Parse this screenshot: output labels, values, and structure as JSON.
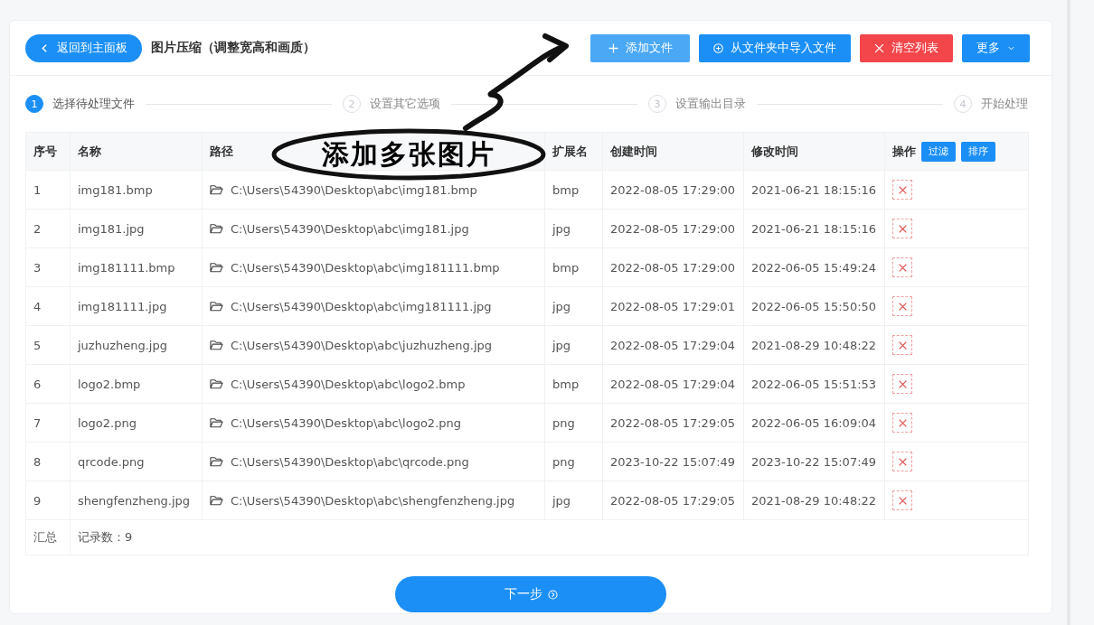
{
  "header": {
    "back_button": "返回到主面板",
    "title": "图片压缩（调整宽高和画质）",
    "buttons": [
      {
        "label": "添加文件",
        "kind": "add"
      },
      {
        "label": "从文件夹中导入文件",
        "kind": "import"
      },
      {
        "label": "清空列表",
        "kind": "clear"
      },
      {
        "label": "更多",
        "kind": "more"
      }
    ]
  },
  "steps": [
    {
      "number": "1",
      "label": "选择待处理文件",
      "selected": true
    },
    {
      "number": "2",
      "label": "设置其它选项",
      "selected": false
    },
    {
      "number": "3",
      "label": "设置输出目录",
      "selected": false
    },
    {
      "number": "4",
      "label": "开始处理",
      "selected": false
    }
  ],
  "table": {
    "columns": [
      "序号",
      "名称",
      "路径",
      "扩展名",
      "创建时间",
      "修改时间",
      "操作"
    ],
    "header_buttons": [
      "过滤",
      "排序"
    ],
    "rows": [
      {
        "index": "1",
        "name": "img181.bmp",
        "path": "C:\\Users\\54390\\Desktop\\abc\\img181.bmp",
        "ext": "bmp",
        "created": "2022-08-05 17:29:00",
        "modified": "2021-06-21 18:15:16"
      },
      {
        "index": "2",
        "name": "img181.jpg",
        "path": "C:\\Users\\54390\\Desktop\\abc\\img181.jpg",
        "ext": "jpg",
        "created": "2022-08-05 17:29:00",
        "modified": "2021-06-21 18:15:16"
      },
      {
        "index": "3",
        "name": "img181111.bmp",
        "path": "C:\\Users\\54390\\Desktop\\abc\\img181111.bmp",
        "ext": "bmp",
        "created": "2022-08-05 17:29:00",
        "modified": "2022-06-05 15:49:24"
      },
      {
        "index": "4",
        "name": "img181111.jpg",
        "path": "C:\\Users\\54390\\Desktop\\abc\\img181111.jpg",
        "ext": "jpg",
        "created": "2022-08-05 17:29:01",
        "modified": "2022-06-05 15:50:50"
      },
      {
        "index": "5",
        "name": "juzhuzheng.jpg",
        "path": "C:\\Users\\54390\\Desktop\\abc\\juzhuzheng.jpg",
        "ext": "jpg",
        "created": "2022-08-05 17:29:04",
        "modified": "2021-08-29 10:48:22"
      },
      {
        "index": "6",
        "name": "logo2.bmp",
        "path": "C:\\Users\\54390\\Desktop\\abc\\logo2.bmp",
        "ext": "bmp",
        "created": "2022-08-05 17:29:04",
        "modified": "2022-06-05 15:51:53"
      },
      {
        "index": "7",
        "name": "logo2.png",
        "path": "C:\\Users\\54390\\Desktop\\abc\\logo2.png",
        "ext": "png",
        "created": "2022-08-05 17:29:05",
        "modified": "2022-06-05 16:09:04"
      },
      {
        "index": "8",
        "name": "qrcode.png",
        "path": "C:\\Users\\54390\\Desktop\\abc\\qrcode.png",
        "ext": "png",
        "created": "2023-10-22 15:07:49",
        "modified": "2023-10-22 15:07:49"
      },
      {
        "index": "9",
        "name": "shengfenzheng.jpg",
        "path": "C:\\Users\\54390\\Desktop\\abc\\shengfenzheng.jpg",
        "ext": "jpg",
        "created": "2022-08-05 17:29:05",
        "modified": "2021-08-29 10:48:22"
      }
    ],
    "summary": {
      "label": "汇总",
      "count": "记录数：9"
    }
  },
  "next_button": "下一步",
  "annotation": {
    "text": "添加多张图片"
  }
}
